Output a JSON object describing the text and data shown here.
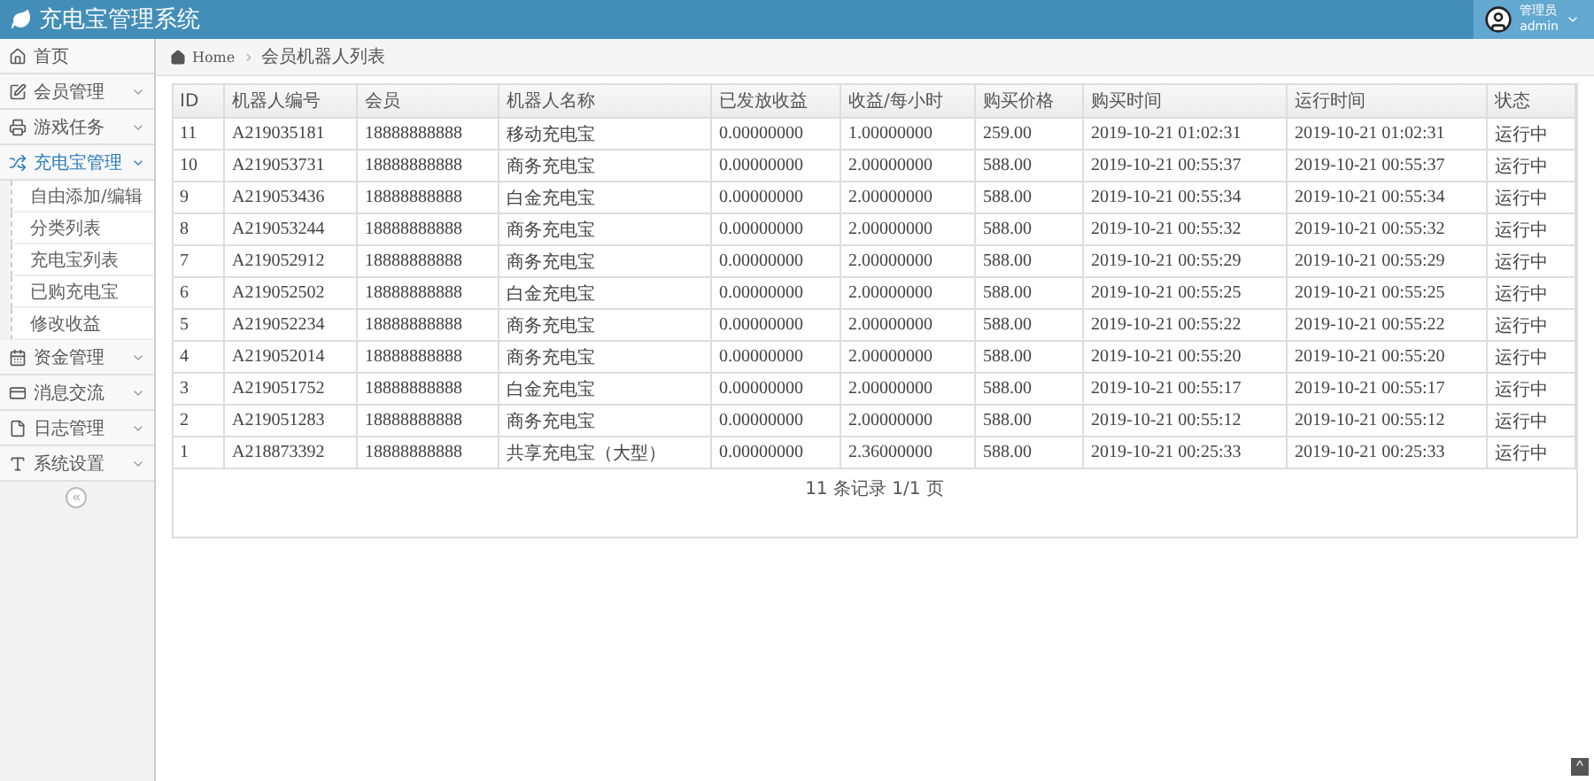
{
  "header": {
    "title": "充电宝管理系统",
    "user_role": "管理员",
    "user_name": "admin"
  },
  "sidebar": {
    "items": [
      {
        "label": "首页",
        "kind": "link",
        "selected": false
      },
      {
        "label": "会员管理",
        "kind": "group",
        "expanded": false,
        "selected": false
      },
      {
        "label": "游戏任务",
        "kind": "group",
        "expanded": false,
        "selected": false
      },
      {
        "label": "充电宝管理",
        "kind": "group",
        "selected": true,
        "expanded": true,
        "children": [
          {
            "label": "自由添加/编辑"
          },
          {
            "label": "分类列表"
          },
          {
            "label": "充电宝列表"
          },
          {
            "label": "已购充电宝"
          },
          {
            "label": "修改收益"
          }
        ]
      },
      {
        "label": "资金管理",
        "kind": "group",
        "expanded": false,
        "selected": false
      },
      {
        "label": "消息交流",
        "kind": "group",
        "expanded": false,
        "selected": false
      },
      {
        "label": "日志管理",
        "kind": "group",
        "expanded": false,
        "selected": false
      },
      {
        "label": "系统设置",
        "kind": "group",
        "expanded": false,
        "selected": false
      }
    ],
    "collapse": "«"
  },
  "breadcrumb": [
    "Home",
    "会员机器人列表"
  ],
  "table": {
    "columns": [
      "ID",
      "机器人编号",
      "会员",
      "机器人名称",
      "已发放收益",
      "收益/每小时",
      "购买价格",
      "购买时间",
      "运行时间",
      "状态"
    ],
    "rows": [
      [
        "11",
        "A219035181",
        "18888888888",
        "移动充电宝",
        "0.00000000",
        "1.00000000",
        "259.00",
        "2019-10-21 01:02:31",
        "2019-10-21 01:02:31",
        "运行中"
      ],
      [
        "10",
        "A219053731",
        "18888888888",
        "商务充电宝",
        "0.00000000",
        "2.00000000",
        "588.00",
        "2019-10-21 00:55:37",
        "2019-10-21 00:55:37",
        "运行中"
      ],
      [
        "9",
        "A219053436",
        "18888888888",
        "白金充电宝",
        "0.00000000",
        "2.00000000",
        "588.00",
        "2019-10-21 00:55:34",
        "2019-10-21 00:55:34",
        "运行中"
      ],
      [
        "8",
        "A219053244",
        "18888888888",
        "商务充电宝",
        "0.00000000",
        "2.00000000",
        "588.00",
        "2019-10-21 00:55:32",
        "2019-10-21 00:55:32",
        "运行中"
      ],
      [
        "7",
        "A219052912",
        "18888888888",
        "商务充电宝",
        "0.00000000",
        "2.00000000",
        "588.00",
        "2019-10-21 00:55:29",
        "2019-10-21 00:55:29",
        "运行中"
      ],
      [
        "6",
        "A219052502",
        "18888888888",
        "白金充电宝",
        "0.00000000",
        "2.00000000",
        "588.00",
        "2019-10-21 00:55:25",
        "2019-10-21 00:55:25",
        "运行中"
      ],
      [
        "5",
        "A219052234",
        "18888888888",
        "商务充电宝",
        "0.00000000",
        "2.00000000",
        "588.00",
        "2019-10-21 00:55:22",
        "2019-10-21 00:55:22",
        "运行中"
      ],
      [
        "4",
        "A219052014",
        "18888888888",
        "商务充电宝",
        "0.00000000",
        "2.00000000",
        "588.00",
        "2019-10-21 00:55:20",
        "2019-10-21 00:55:20",
        "运行中"
      ],
      [
        "3",
        "A219051752",
        "18888888888",
        "白金充电宝",
        "0.00000000",
        "2.00000000",
        "588.00",
        "2019-10-21 00:55:17",
        "2019-10-21 00:55:17",
        "运行中"
      ],
      [
        "2",
        "A219051283",
        "18888888888",
        "商务充电宝",
        "0.00000000",
        "2.00000000",
        "588.00",
        "2019-10-21 00:55:12",
        "2019-10-21 00:55:12",
        "运行中"
      ],
      [
        "1",
        "A218873392",
        "18888888888",
        "共享充电宝（大型）",
        "0.00000000",
        "2.36000000",
        "588.00",
        "2019-10-21 00:25:33",
        "2019-10-21 00:25:33",
        "运行中"
      ]
    ],
    "footer": "11 条记录 1/1 页"
  },
  "scroll_top": "^"
}
